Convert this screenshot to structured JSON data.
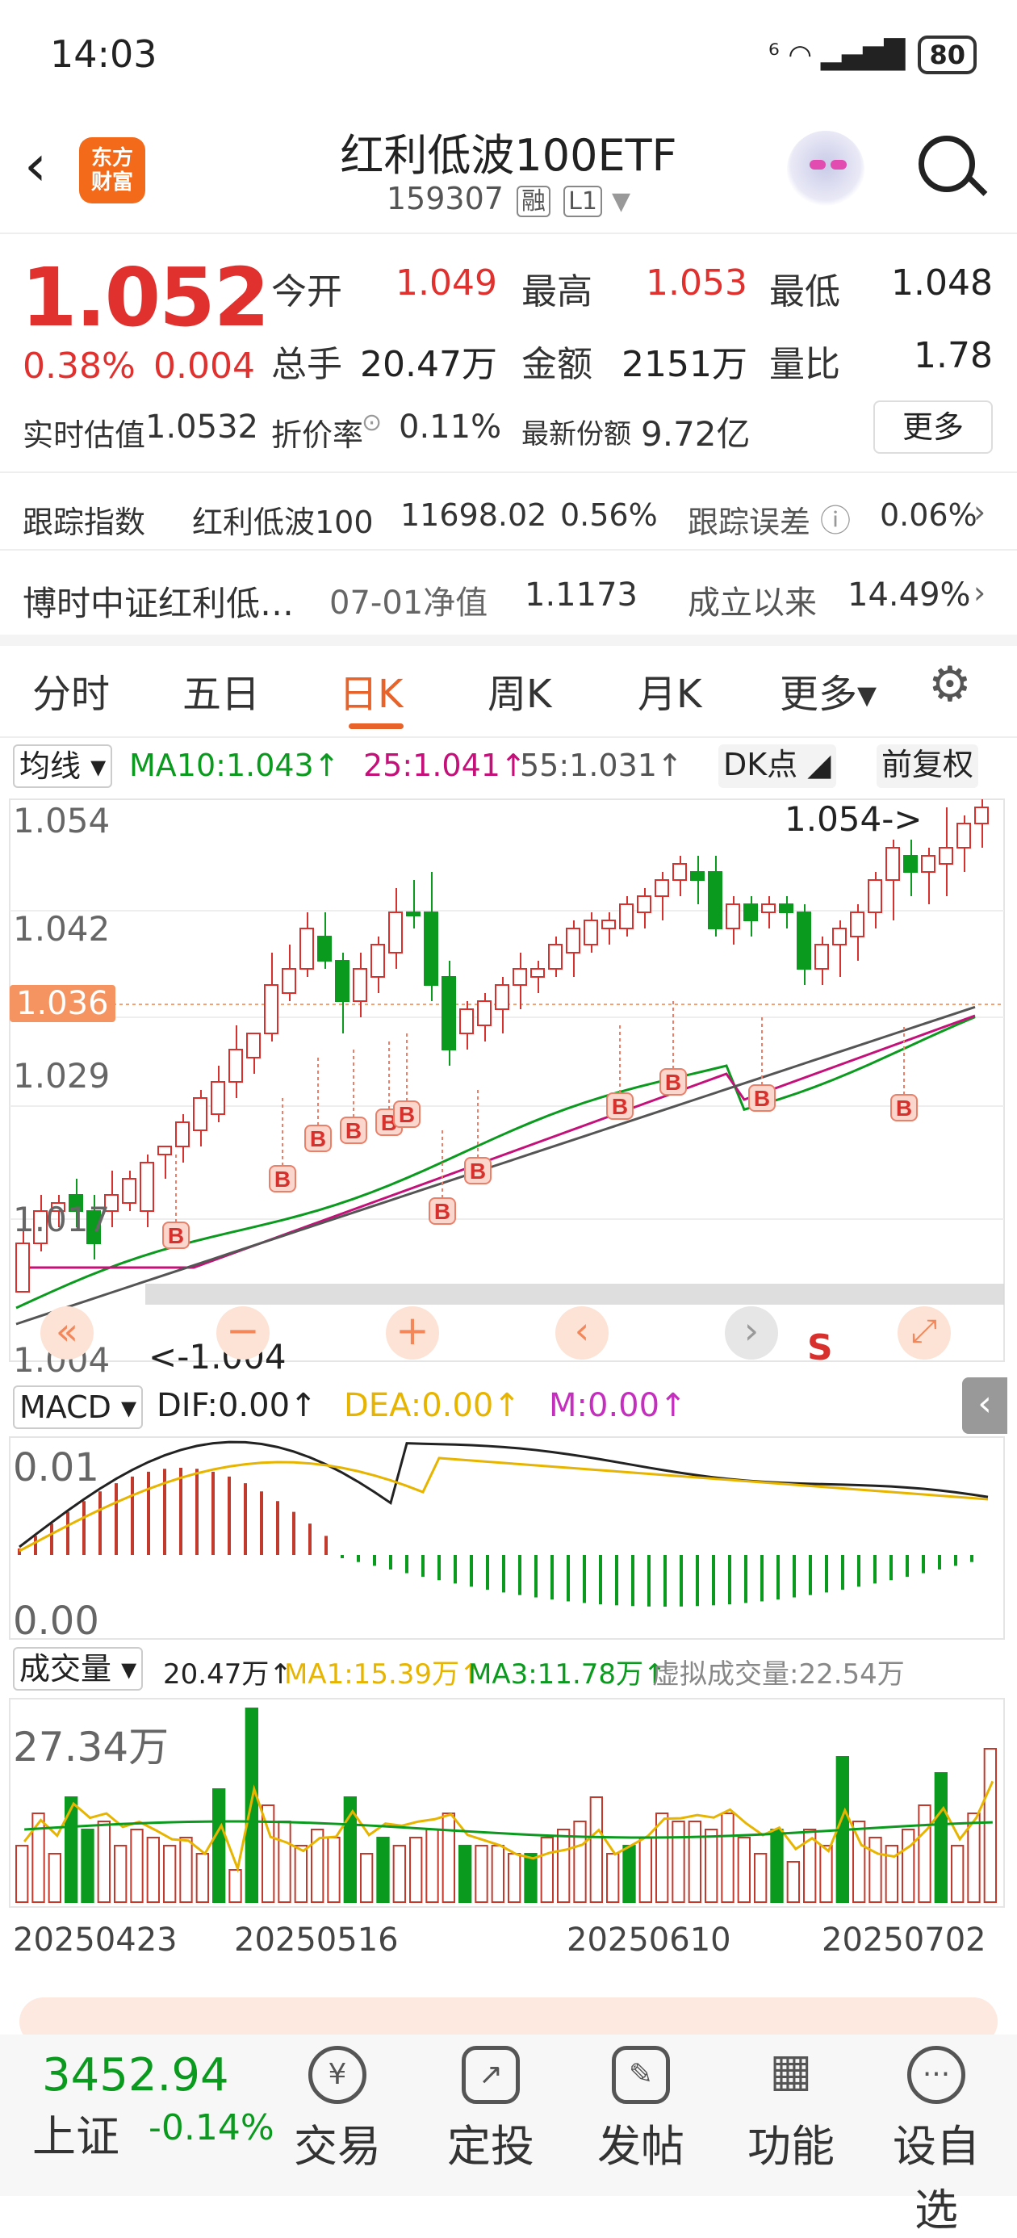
{
  "status_bar": {
    "time": "14:03",
    "signal": "⁶ ◠ ▂▄▆█",
    "battery": "80"
  },
  "header": {
    "title": "红利低波100ETF",
    "code": "159307",
    "tag1": "融",
    "tag2": "L1",
    "logo_text": "东方\n财富"
  },
  "quote": {
    "price": "1.052",
    "change_pct": "0.38%",
    "change_val": "0.004",
    "open_label": "今开",
    "open": "1.049",
    "high_label": "最高",
    "high": "1.053",
    "low_label": "最低",
    "low": "1.048",
    "volume_label": "总手",
    "volume": "20.47万",
    "amount_label": "金额",
    "amount": "2151万",
    "ratio_label": "量比",
    "ratio": "1.78",
    "iopv_label": "实时估值",
    "iopv": "1.0532",
    "discount_label": "折价率",
    "discount": "0.11%",
    "shares_label": "最新份额",
    "shares": "9.72亿",
    "more_label": "更多"
  },
  "tracking": {
    "label": "跟踪指数",
    "index_name": "红利低波100",
    "index_value": "11698.02",
    "index_pct": "0.56%",
    "error_label": "跟踪误差",
    "error_value": "0.06%"
  },
  "fund": {
    "name": "博时中证红利低…",
    "nav_label": "07-01净值",
    "nav": "1.1173",
    "since_label": "成立以来",
    "since_value": "14.49%"
  },
  "tabs": [
    {
      "label": "分时"
    },
    {
      "label": "五日"
    },
    {
      "label": "日K"
    },
    {
      "label": "周K"
    },
    {
      "label": "月K"
    },
    {
      "label": "更多▾"
    }
  ],
  "kline": {
    "ma_select": "均线",
    "ma10": "MA10:1.043↑",
    "ma25": "25:1.041↑",
    "ma55": "55:1.031↑",
    "dk_label": "DK点",
    "adj_label": "前复权",
    "y_ticks": [
      "1.054",
      "1.042",
      "1.036",
      "1.029",
      "1.017",
      "1.004"
    ],
    "max_label": "1.054->",
    "min_label": "<-1.004",
    "buy_marker": "B",
    "sell_marker": "S",
    "colors": {
      "up": "#d8302c",
      "down": "#0a9a1e",
      "ma10": "#0a9a1e",
      "ma25": "#c4117a",
      "ma55": "#555555"
    }
  },
  "macd": {
    "select": "MACD",
    "dif": "DIF:0.00↑",
    "dea": "DEA:0.00↑",
    "m": "M:0.00↑",
    "y_ticks": [
      "0.01",
      "0.00"
    ]
  },
  "volume": {
    "select": "成交量",
    "vol": "20.47万↑",
    "ma1": "MA1:15.39万↑",
    "ma3": "MA3:11.78万↑",
    "virtual": "虚拟成交量:22.54万",
    "y_top": "27.34万",
    "dates": [
      "20250423",
      "20250516",
      "20250610",
      "20250702"
    ]
  },
  "bottom": {
    "index_value": "3452.94",
    "index_name": "上证",
    "index_pct": "-0.14%",
    "items": [
      {
        "label": "交易",
        "icon": "trade-icon"
      },
      {
        "label": "定投",
        "icon": "invest-icon"
      },
      {
        "label": "发帖",
        "icon": "post-icon"
      },
      {
        "label": "功能",
        "icon": "function-icon"
      },
      {
        "label": "设自选",
        "icon": "watchlist-icon"
      }
    ]
  }
}
